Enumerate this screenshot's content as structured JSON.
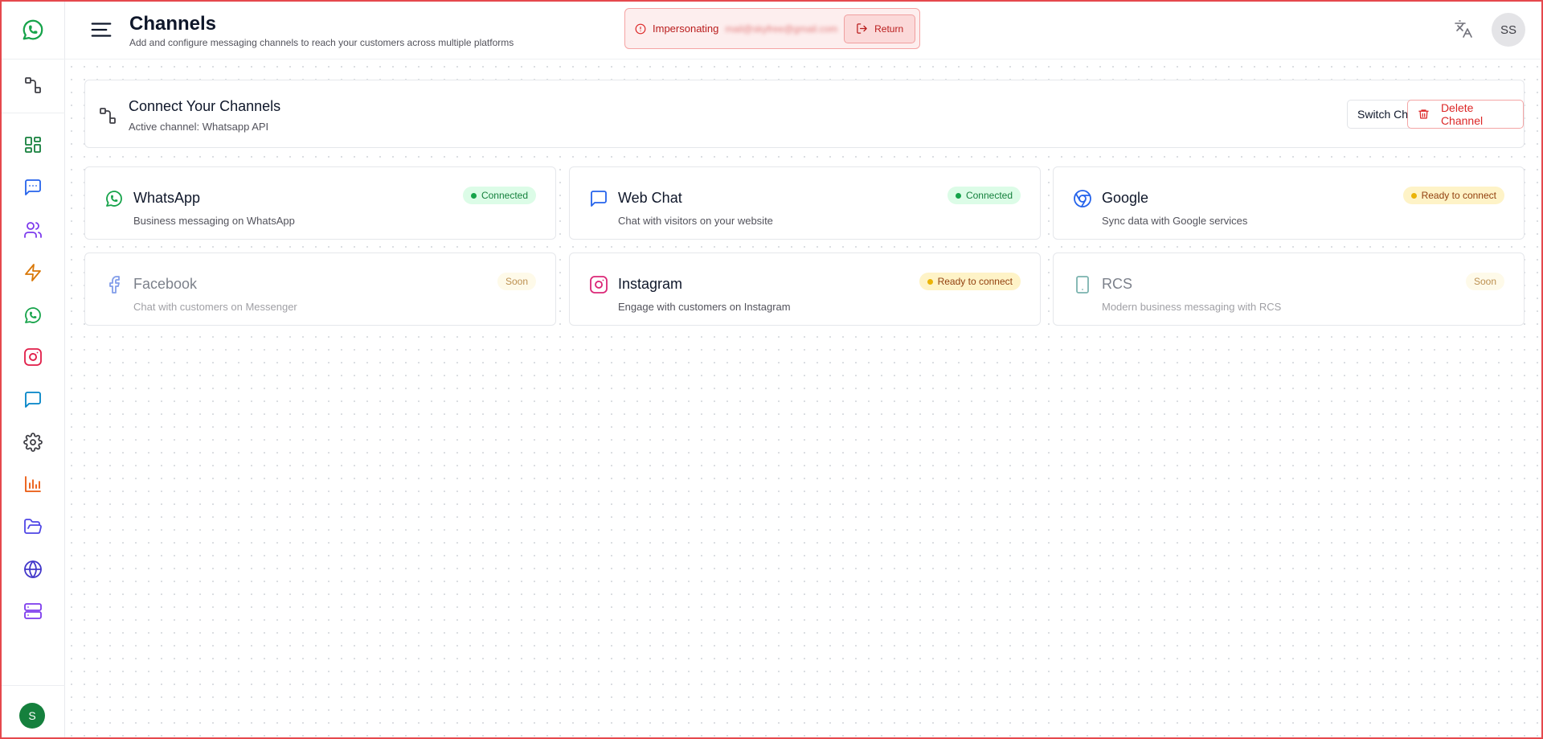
{
  "header": {
    "title": "Channels",
    "subtitle": "Add and configure messaging channels to reach your customers across multiple platforms",
    "impersonating_label": "Impersonating",
    "impersonating_email": "mail@skyfree@gmail.com",
    "return_label": "Return",
    "user_initials": "SS"
  },
  "sidebar": {
    "user_initial": "S",
    "items": [
      {
        "name": "channels-icon",
        "color": "#3f3f46"
      },
      {
        "name": "dashboard-icon",
        "color": "#15803d"
      },
      {
        "name": "chat-icon",
        "color": "#2563eb"
      },
      {
        "name": "users-icon",
        "color": "#7c3aed"
      },
      {
        "name": "lightning-icon",
        "color": "#d97706"
      },
      {
        "name": "whatsapp-icon",
        "color": "#16a34a"
      },
      {
        "name": "instagram-icon",
        "color": "#e11d48"
      },
      {
        "name": "message-icon",
        "color": "#0284c7"
      },
      {
        "name": "settings-icon",
        "color": "#3f3f46"
      },
      {
        "name": "chart-icon",
        "color": "#ea580c"
      },
      {
        "name": "folder-icon",
        "color": "#4f46e5"
      },
      {
        "name": "globe-icon",
        "color": "#4338ca"
      },
      {
        "name": "server-icon",
        "color": "#7c3aed"
      }
    ]
  },
  "connect": {
    "title": "Connect Your Channels",
    "active": "Active channel: Whatsapp API",
    "switch_label": "Switch Channel",
    "delete_label": "Delete Channel"
  },
  "channels": [
    {
      "name": "WhatsApp",
      "desc": "Business messaging on WhatsApp",
      "status": "Connected",
      "state": "connected",
      "icon": "whatsapp-icon"
    },
    {
      "name": "Web Chat",
      "desc": "Chat with visitors on your website",
      "status": "Connected",
      "state": "connected",
      "icon": "chat-bubble-icon"
    },
    {
      "name": "Google",
      "desc": "Sync data with Google services",
      "status": "Ready to connect",
      "state": "ready",
      "icon": "google-icon"
    },
    {
      "name": "Facebook",
      "desc": "Chat with customers on Messenger",
      "status": "Soon",
      "state": "soon",
      "icon": "facebook-icon"
    },
    {
      "name": "Instagram",
      "desc": "Engage with customers on Instagram",
      "status": "Ready to connect",
      "state": "ready",
      "icon": "instagram-icon"
    },
    {
      "name": "RCS",
      "desc": "Modern business messaging with RCS",
      "status": "Soon",
      "state": "soon",
      "icon": "phone-icon"
    }
  ]
}
